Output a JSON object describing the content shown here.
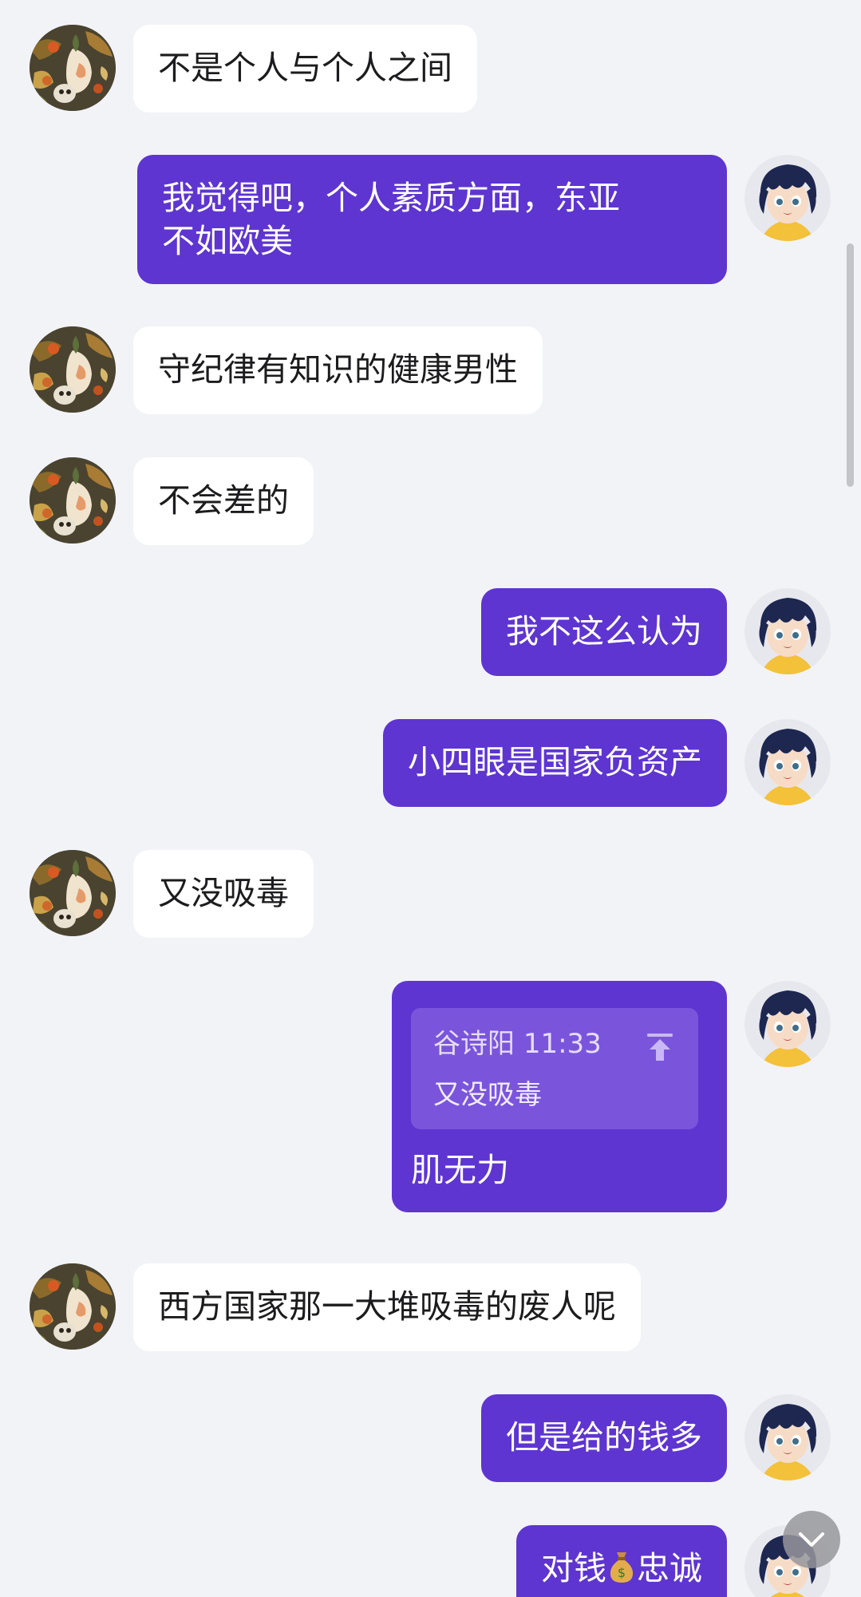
{
  "colors": {
    "background": "#f2f3f7",
    "incoming_bubble": "#ffffff",
    "outgoing_bubble": "#5e35d0",
    "quote_box": "#7a55dc"
  },
  "messages": [
    {
      "side": "in",
      "text": "不是个人与个人之间"
    },
    {
      "side": "out",
      "text_line1": "我觉得吧，个人素质方面，东亚",
      "text_line2": "不如欧美"
    },
    {
      "side": "in",
      "text": "守纪律有知识的健康男性"
    },
    {
      "side": "in",
      "text": "不会差的"
    },
    {
      "side": "out",
      "text": "我不这么认为"
    },
    {
      "side": "out",
      "text": "小四眼是国家负资产"
    },
    {
      "side": "in",
      "text": "又没吸毒"
    },
    {
      "side": "out",
      "quote": {
        "sender": "谷诗阳",
        "time": "11:33",
        "text": "又没吸毒"
      },
      "text": "肌无力"
    },
    {
      "side": "in",
      "text": "西方国家那一大堆吸毒的废人呢"
    },
    {
      "side": "out",
      "text": "但是给的钱多"
    },
    {
      "side": "out",
      "text_before": "对钱",
      "emoji": "money-bag",
      "text_after": "忠诚"
    }
  ],
  "icons": {
    "quote_jump": "arrow-up-to-top-icon",
    "scroll_down": "chevron-down-icon"
  }
}
